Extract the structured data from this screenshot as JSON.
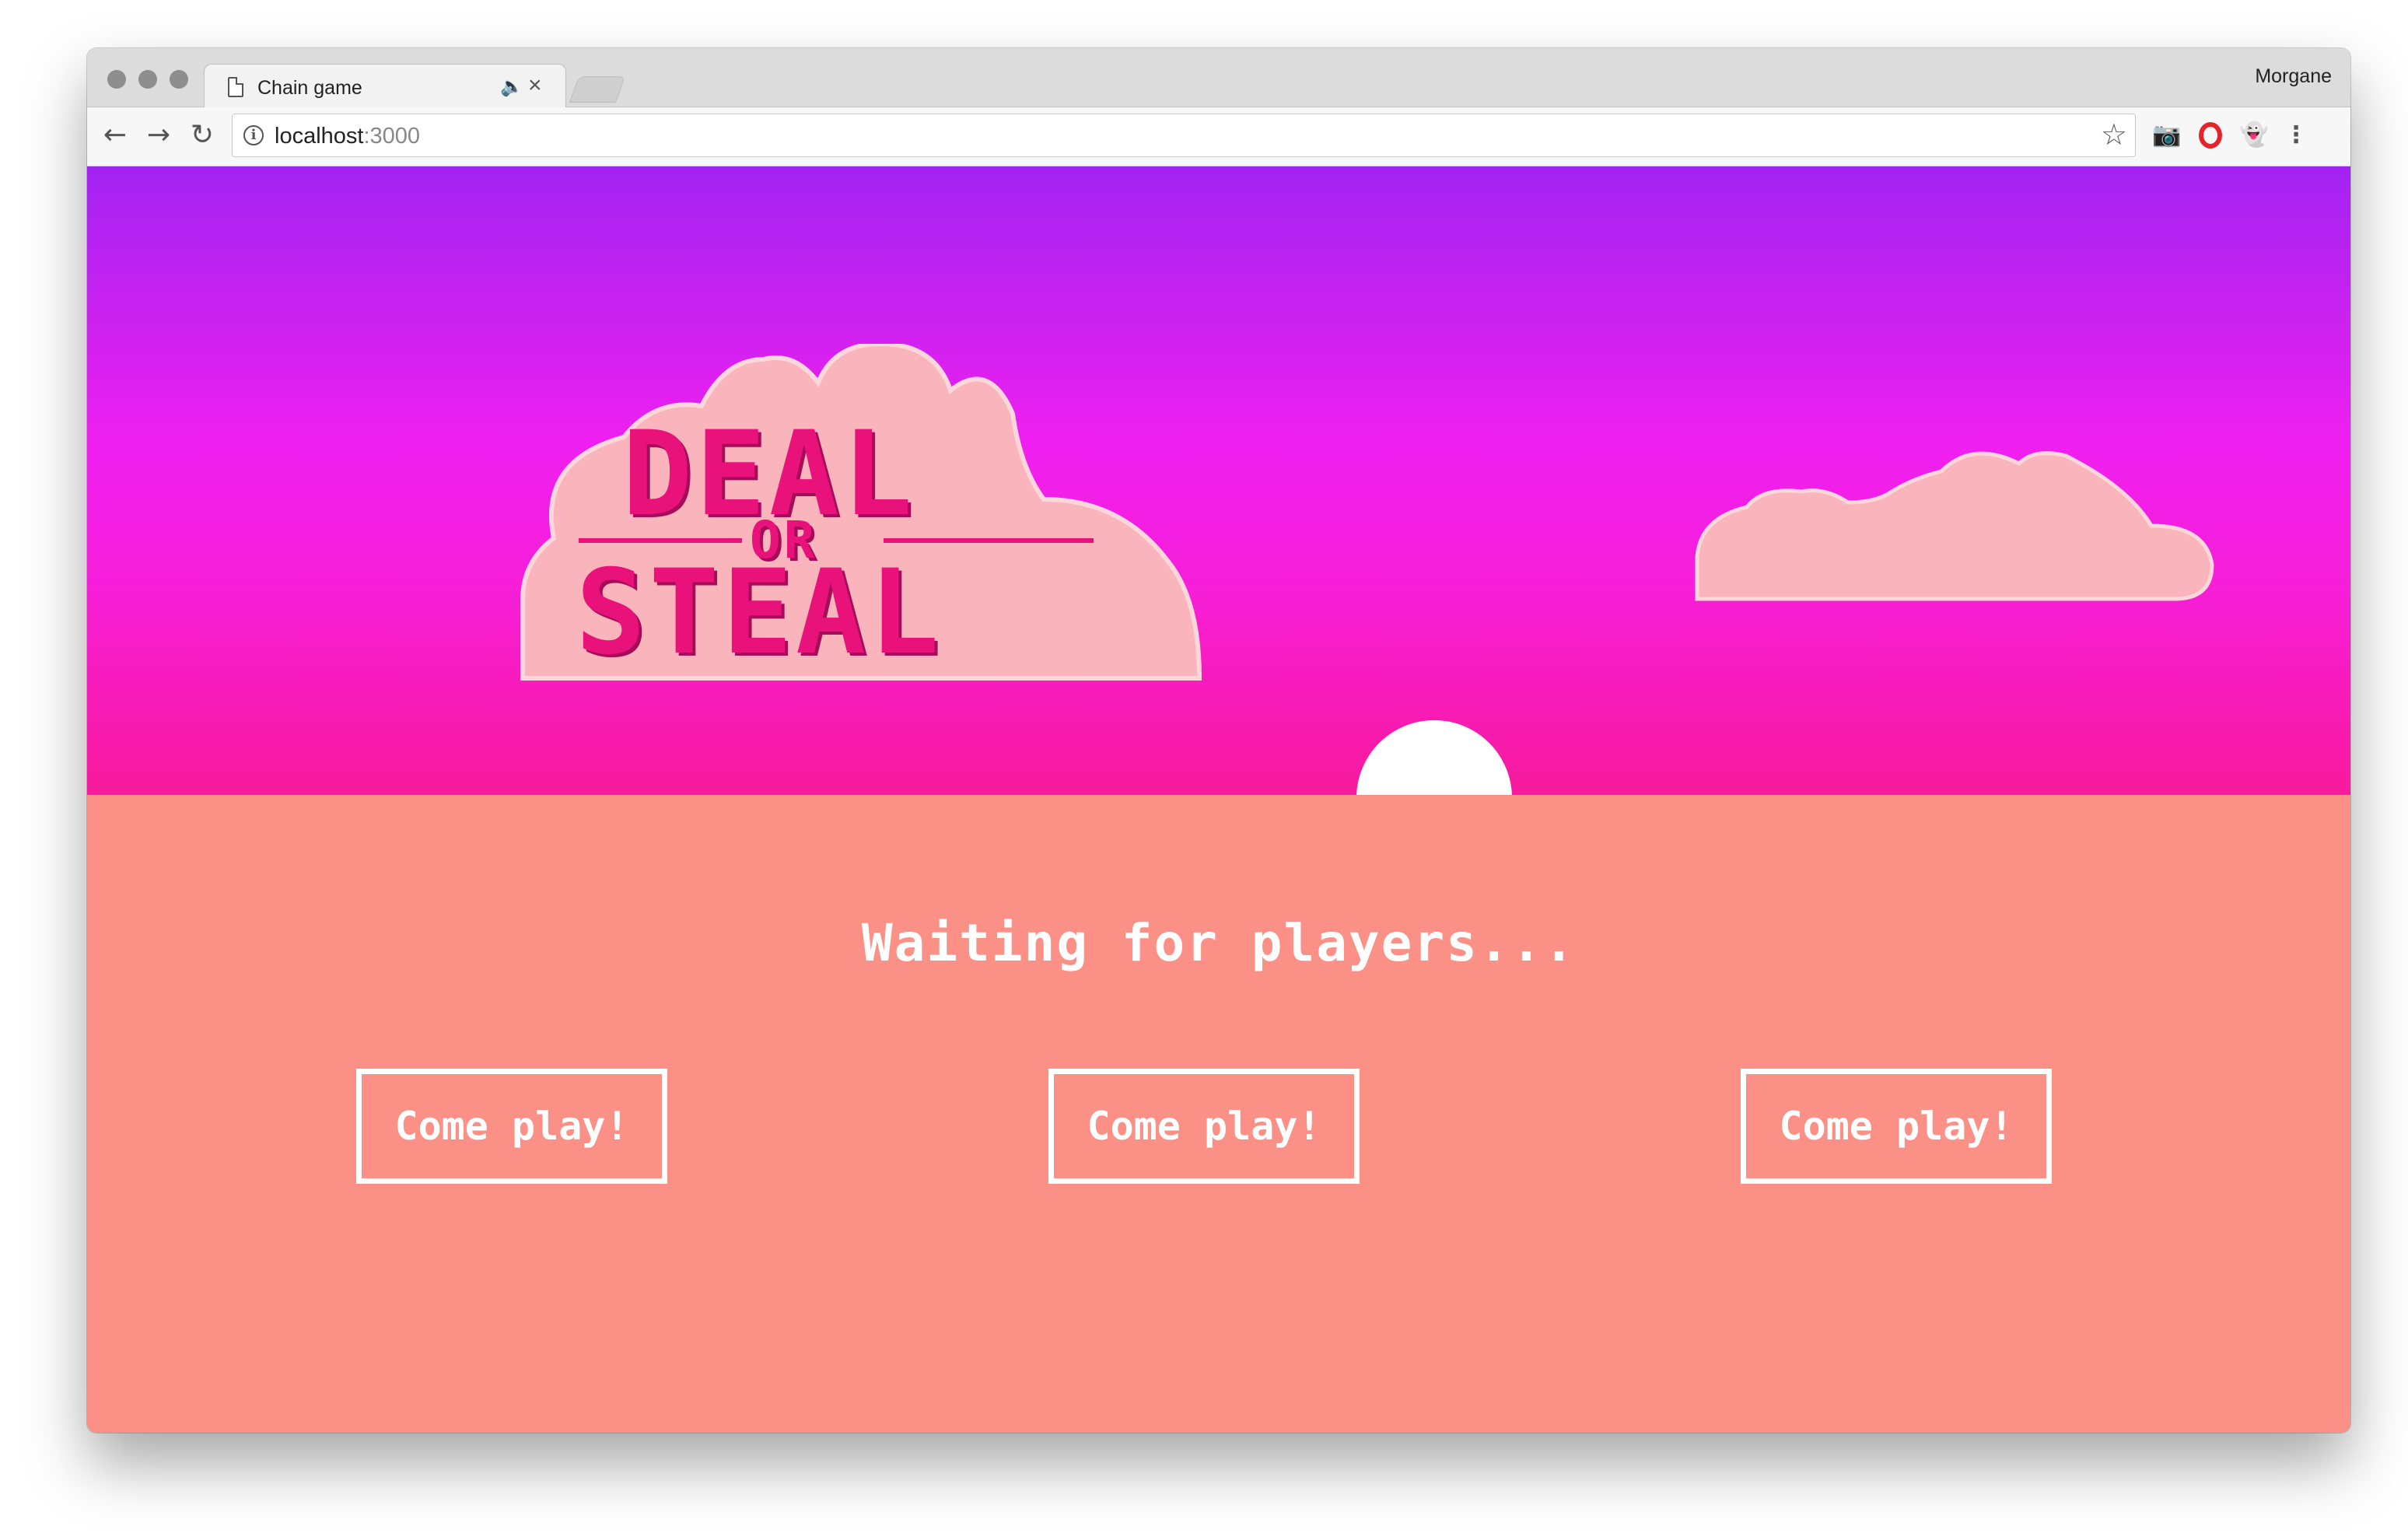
{
  "browser": {
    "tab_title": "Chain game",
    "profile_name": "Morgane",
    "url_host": "localhost",
    "url_port": ":3000",
    "icons": {
      "back": "back-arrow-icon",
      "forward": "forward-arrow-icon",
      "reload": "reload-icon",
      "info": "info-icon",
      "star": "star-icon",
      "camera": "camera-icon",
      "opera": "opera-icon",
      "ghost": "ghostery-icon",
      "menu": "kebab-menu-icon"
    }
  },
  "game": {
    "logo_line1": "DEAL",
    "logo_line2": "OR",
    "logo_line3": "STEAL",
    "status_text": "Waiting for players...",
    "play_buttons": [
      "Come play!",
      "Come play!",
      "Come play!"
    ]
  },
  "colors": {
    "sky_top": "#a223f2",
    "sky_bottom": "#f71b9d",
    "ground": "#fb9086",
    "cloud": "#f9b4bc",
    "logo": "#e8127a",
    "sun": "#ffffff"
  }
}
